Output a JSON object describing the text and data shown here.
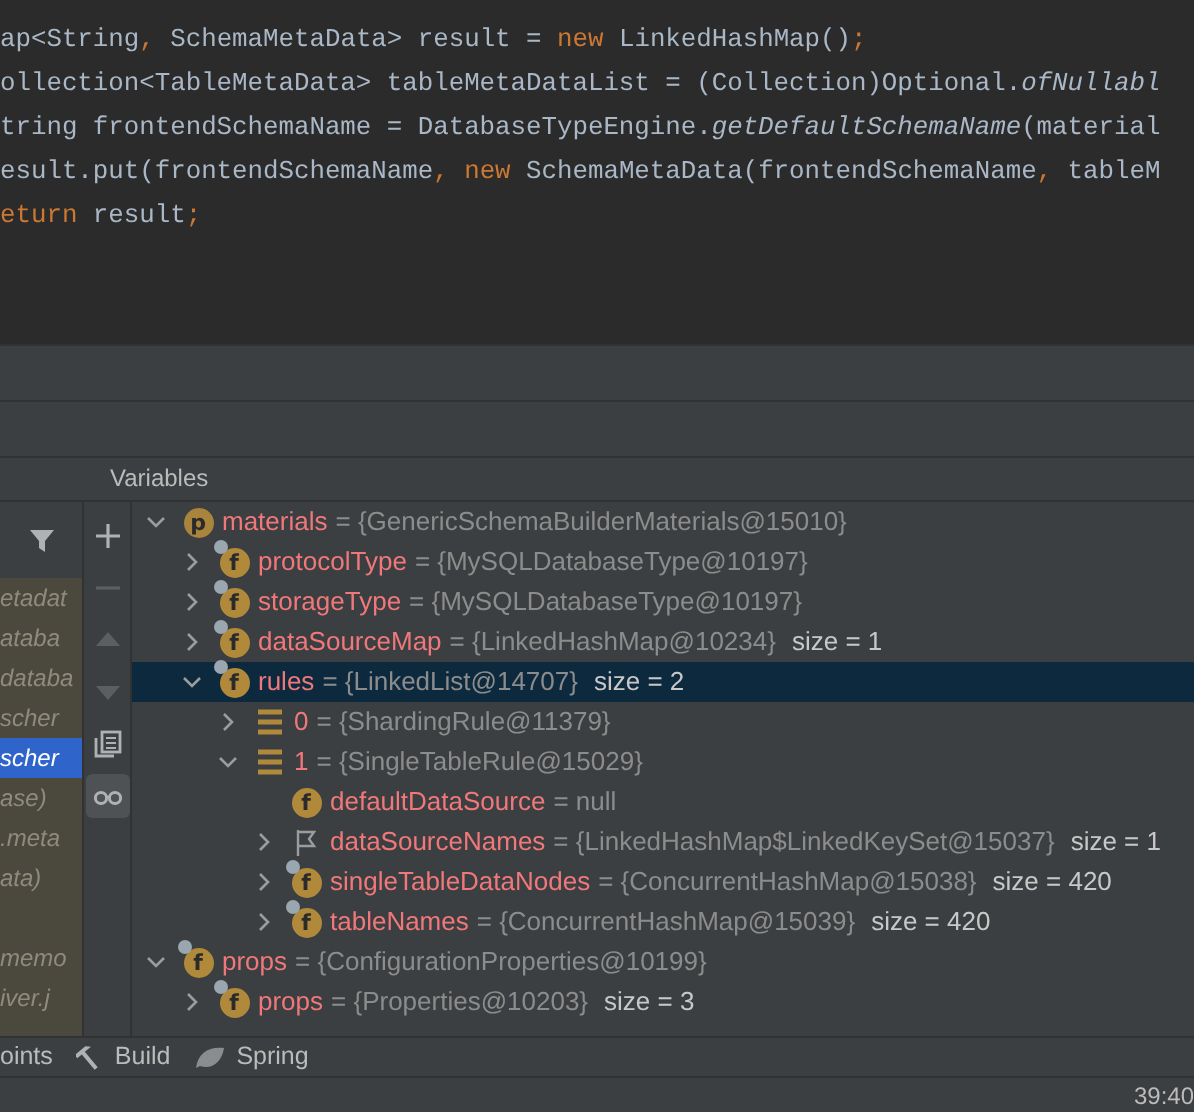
{
  "code_lines": [
    [
      {
        "text": "ap<String",
        "kind": "plain"
      },
      {
        "text": ",",
        "kind": "keyword"
      },
      {
        "text": " SchemaMetaData> result = ",
        "kind": "plain"
      },
      {
        "text": "new",
        "kind": "keyword"
      },
      {
        "text": " LinkedHashMap()",
        "kind": "plain"
      },
      {
        "text": ";",
        "kind": "keyword"
      }
    ],
    [
      {
        "text": "ollection<TableMetaData> tableMetaDataList = (Collection)Optional.",
        "kind": "plain"
      },
      {
        "text": "ofNullabl",
        "kind": "italic"
      }
    ],
    [
      {
        "text": "tring frontendSchemaName = DatabaseTypeEngine.",
        "kind": "plain"
      },
      {
        "text": "getDefaultSchemaName",
        "kind": "italic"
      },
      {
        "text": "(material",
        "kind": "plain"
      }
    ],
    [
      {
        "text": "esult.put(frontendSchemaName",
        "kind": "plain"
      },
      {
        "text": ", new",
        "kind": "keyword"
      },
      {
        "text": " SchemaMetaData(frontendSchemaName",
        "kind": "plain"
      },
      {
        "text": ", ",
        "kind": "keyword"
      },
      {
        "text": "tableM",
        "kind": "plain"
      }
    ],
    [
      {
        "text": "eturn",
        "kind": "keyword"
      },
      {
        "text": " result",
        "kind": "plain"
      },
      {
        "text": ";",
        "kind": "keyword"
      }
    ]
  ],
  "variables_panel": {
    "title": "Variables",
    "frames": [
      {
        "text": "etadat",
        "selected": false
      },
      {
        "text": "ataba",
        "selected": false
      },
      {
        "text": "databa",
        "selected": false
      },
      {
        "text": "scher",
        "selected": false
      },
      {
        "text": "scher",
        "selected": true
      },
      {
        "text": "ase)",
        "selected": false
      },
      {
        "text": ".meta",
        "selected": false
      },
      {
        "text": "ata)",
        "selected": false
      },
      {
        "selected": false
      },
      {
        "text": "memo",
        "selected": false
      },
      {
        "text": "iver.j",
        "selected": false
      }
    ],
    "toolbar": [
      {
        "kind": "add",
        "disabled": false,
        "on": false
      },
      {
        "kind": "remove",
        "disabled": true,
        "on": false
      },
      {
        "kind": "up",
        "disabled": true,
        "on": false
      },
      {
        "kind": "down",
        "disabled": true,
        "on": false
      },
      {
        "kind": "copy",
        "disabled": false,
        "on": false
      },
      {
        "kind": "watches",
        "disabled": false,
        "on": true
      }
    ],
    "tree": [
      {
        "name": "materials",
        "value": "= {GenericSchemaBuilderMaterials@15010}",
        "kind": "badge",
        "letter": "p",
        "overlay": false,
        "expanded": true,
        "selected": false,
        "children": [
          {
            "name": "protocolType",
            "value": "= {MySQLDatabaseType@10197}",
            "kind": "field",
            "letter": "f",
            "overlay": true,
            "expanded": false,
            "selected": false
          },
          {
            "name": "storageType",
            "value": "= {MySQLDatabaseType@10197}",
            "kind": "field",
            "letter": "f",
            "overlay": true,
            "expanded": false,
            "selected": false
          },
          {
            "name": "dataSourceMap",
            "value": "= {LinkedHashMap@10234}",
            "size": "size = 1",
            "kind": "field",
            "letter": "f",
            "overlay": true,
            "expanded": false,
            "selected": false
          },
          {
            "name": "rules",
            "value": "= {LinkedList@14707}",
            "size": "size = 2",
            "kind": "field",
            "letter": "f",
            "overlay": true,
            "expanded": true,
            "selected": true,
            "children": [
              {
                "name": "0",
                "value": "= {ShardingRule@11379}",
                "kind": "element",
                "expanded": false,
                "selected": false
              },
              {
                "name": "1",
                "value": "= {SingleTableRule@15029}",
                "kind": "element",
                "expanded": true,
                "selected": false,
                "children": [
                  {
                    "name": "defaultDataSource",
                    "value": "= null",
                    "kind": "field",
                    "letter": "f",
                    "overlay": false,
                    "selected": false
                  },
                  {
                    "name": "dataSourceNames",
                    "value": "= {LinkedHashMap$LinkedKeySet@15037}",
                    "size": "size = 1",
                    "kind": "flag",
                    "expanded": false,
                    "selected": false
                  },
                  {
                    "name": "singleTableDataNodes",
                    "value": "= {ConcurrentHashMap@15038}",
                    "size": "size = 420",
                    "kind": "field",
                    "letter": "f",
                    "overlay": true,
                    "expanded": false,
                    "selected": false
                  },
                  {
                    "name": "tableNames",
                    "value": "= {ConcurrentHashMap@15039}",
                    "size": "size = 420",
                    "kind": "field",
                    "letter": "f",
                    "overlay": true,
                    "expanded": false,
                    "selected": false
                  }
                ]
              }
            ]
          }
        ]
      },
      {
        "name": "props",
        "value": "= {ConfigurationProperties@10199}",
        "kind": "field",
        "letter": "f",
        "overlay": true,
        "expanded": true,
        "selected": false,
        "children": [
          {
            "name": "props",
            "value": "= {Properties@10203}",
            "size": "size = 3",
            "kind": "field",
            "letter": "f",
            "overlay": true,
            "expanded": false,
            "selected": false
          }
        ]
      }
    ]
  },
  "tool_windows": [
    {
      "label": "oints",
      "kind": "cut"
    },
    {
      "label": "Build",
      "kind": "build"
    },
    {
      "label": "Spring",
      "kind": "spring"
    }
  ],
  "status_bar": {
    "position": "39:40"
  }
}
